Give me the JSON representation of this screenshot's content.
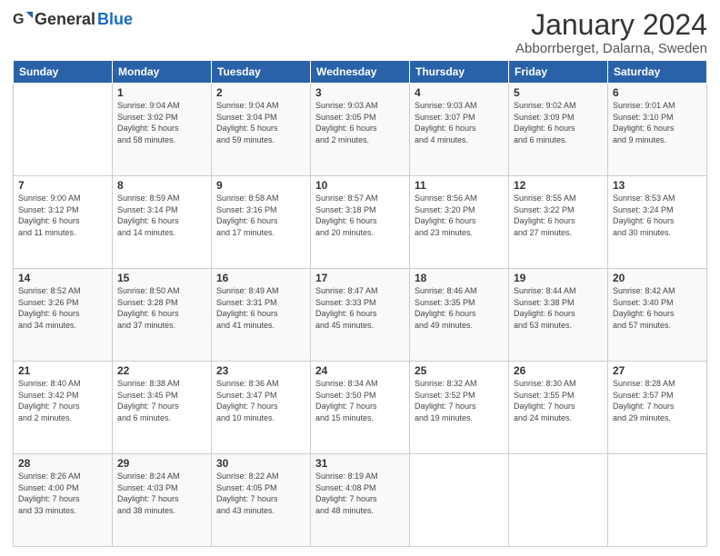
{
  "logo": {
    "general": "General",
    "blue": "Blue"
  },
  "header": {
    "month": "January 2024",
    "location": "Abborrberget, Dalarna, Sweden"
  },
  "weekdays": [
    "Sunday",
    "Monday",
    "Tuesday",
    "Wednesday",
    "Thursday",
    "Friday",
    "Saturday"
  ],
  "weeks": [
    [
      {
        "day": "",
        "info": ""
      },
      {
        "day": "1",
        "info": "Sunrise: 9:04 AM\nSunset: 3:02 PM\nDaylight: 5 hours\nand 58 minutes."
      },
      {
        "day": "2",
        "info": "Sunrise: 9:04 AM\nSunset: 3:04 PM\nDaylight: 5 hours\nand 59 minutes."
      },
      {
        "day": "3",
        "info": "Sunrise: 9:03 AM\nSunset: 3:05 PM\nDaylight: 6 hours\nand 2 minutes."
      },
      {
        "day": "4",
        "info": "Sunrise: 9:03 AM\nSunset: 3:07 PM\nDaylight: 6 hours\nand 4 minutes."
      },
      {
        "day": "5",
        "info": "Sunrise: 9:02 AM\nSunset: 3:09 PM\nDaylight: 6 hours\nand 6 minutes."
      },
      {
        "day": "6",
        "info": "Sunrise: 9:01 AM\nSunset: 3:10 PM\nDaylight: 6 hours\nand 9 minutes."
      }
    ],
    [
      {
        "day": "7",
        "info": "Sunrise: 9:00 AM\nSunset: 3:12 PM\nDaylight: 6 hours\nand 11 minutes."
      },
      {
        "day": "8",
        "info": "Sunrise: 8:59 AM\nSunset: 3:14 PM\nDaylight: 6 hours\nand 14 minutes."
      },
      {
        "day": "9",
        "info": "Sunrise: 8:58 AM\nSunset: 3:16 PM\nDaylight: 6 hours\nand 17 minutes."
      },
      {
        "day": "10",
        "info": "Sunrise: 8:57 AM\nSunset: 3:18 PM\nDaylight: 6 hours\nand 20 minutes."
      },
      {
        "day": "11",
        "info": "Sunrise: 8:56 AM\nSunset: 3:20 PM\nDaylight: 6 hours\nand 23 minutes."
      },
      {
        "day": "12",
        "info": "Sunrise: 8:55 AM\nSunset: 3:22 PM\nDaylight: 6 hours\nand 27 minutes."
      },
      {
        "day": "13",
        "info": "Sunrise: 8:53 AM\nSunset: 3:24 PM\nDaylight: 6 hours\nand 30 minutes."
      }
    ],
    [
      {
        "day": "14",
        "info": "Sunrise: 8:52 AM\nSunset: 3:26 PM\nDaylight: 6 hours\nand 34 minutes."
      },
      {
        "day": "15",
        "info": "Sunrise: 8:50 AM\nSunset: 3:28 PM\nDaylight: 6 hours\nand 37 minutes."
      },
      {
        "day": "16",
        "info": "Sunrise: 8:49 AM\nSunset: 3:31 PM\nDaylight: 6 hours\nand 41 minutes."
      },
      {
        "day": "17",
        "info": "Sunrise: 8:47 AM\nSunset: 3:33 PM\nDaylight: 6 hours\nand 45 minutes."
      },
      {
        "day": "18",
        "info": "Sunrise: 8:46 AM\nSunset: 3:35 PM\nDaylight: 6 hours\nand 49 minutes."
      },
      {
        "day": "19",
        "info": "Sunrise: 8:44 AM\nSunset: 3:38 PM\nDaylight: 6 hours\nand 53 minutes."
      },
      {
        "day": "20",
        "info": "Sunrise: 8:42 AM\nSunset: 3:40 PM\nDaylight: 6 hours\nand 57 minutes."
      }
    ],
    [
      {
        "day": "21",
        "info": "Sunrise: 8:40 AM\nSunset: 3:42 PM\nDaylight: 7 hours\nand 2 minutes."
      },
      {
        "day": "22",
        "info": "Sunrise: 8:38 AM\nSunset: 3:45 PM\nDaylight: 7 hours\nand 6 minutes."
      },
      {
        "day": "23",
        "info": "Sunrise: 8:36 AM\nSunset: 3:47 PM\nDaylight: 7 hours\nand 10 minutes."
      },
      {
        "day": "24",
        "info": "Sunrise: 8:34 AM\nSunset: 3:50 PM\nDaylight: 7 hours\nand 15 minutes."
      },
      {
        "day": "25",
        "info": "Sunrise: 8:32 AM\nSunset: 3:52 PM\nDaylight: 7 hours\nand 19 minutes."
      },
      {
        "day": "26",
        "info": "Sunrise: 8:30 AM\nSunset: 3:55 PM\nDaylight: 7 hours\nand 24 minutes."
      },
      {
        "day": "27",
        "info": "Sunrise: 8:28 AM\nSunset: 3:57 PM\nDaylight: 7 hours\nand 29 minutes."
      }
    ],
    [
      {
        "day": "28",
        "info": "Sunrise: 8:26 AM\nSunset: 4:00 PM\nDaylight: 7 hours\nand 33 minutes."
      },
      {
        "day": "29",
        "info": "Sunrise: 8:24 AM\nSunset: 4:03 PM\nDaylight: 7 hours\nand 38 minutes."
      },
      {
        "day": "30",
        "info": "Sunrise: 8:22 AM\nSunset: 4:05 PM\nDaylight: 7 hours\nand 43 minutes."
      },
      {
        "day": "31",
        "info": "Sunrise: 8:19 AM\nSunset: 4:08 PM\nDaylight: 7 hours\nand 48 minutes."
      },
      {
        "day": "",
        "info": ""
      },
      {
        "day": "",
        "info": ""
      },
      {
        "day": "",
        "info": ""
      }
    ]
  ]
}
